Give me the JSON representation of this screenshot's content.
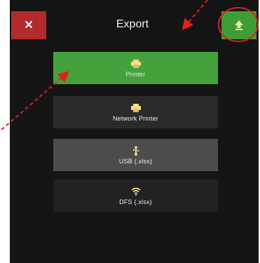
{
  "header": {
    "close_symbol": "×",
    "title": "Export",
    "export_icon": "export-upload-icon"
  },
  "options": [
    {
      "label": "Printer",
      "icon": "printer-icon",
      "state": "selected"
    },
    {
      "label": "Network Printer",
      "icon": "network-printer-icon",
      "state": "normal"
    },
    {
      "label": "USB (.xlsx)",
      "icon": "usb-icon",
      "state": "highlighted"
    },
    {
      "label": "DFS (.xlsx)",
      "icon": "wifi-icon",
      "state": "normal"
    }
  ],
  "colors": {
    "background": "#151515",
    "close_red": "#b32a2c",
    "accent_green": "#3f9d38",
    "annotation_red": "#e0201f"
  }
}
